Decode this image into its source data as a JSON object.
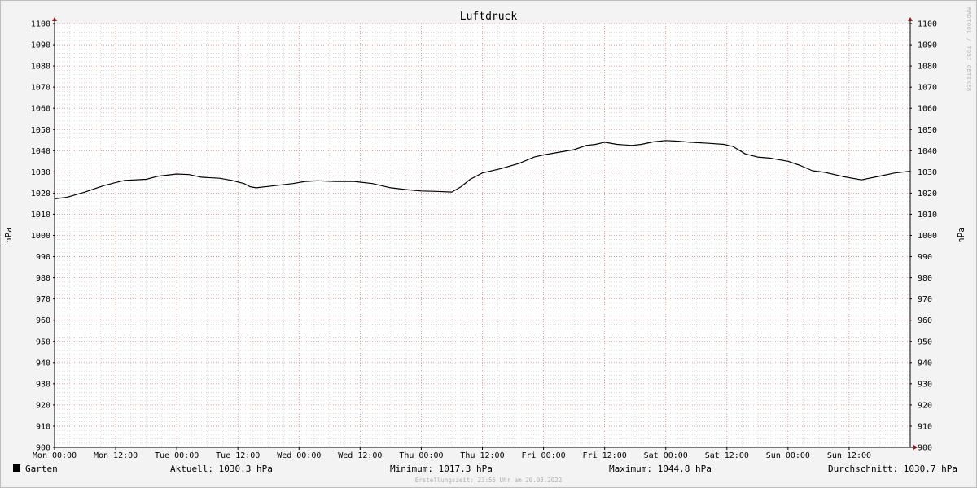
{
  "chart_data": {
    "type": "line",
    "title": "Luftdruck",
    "ylabel": "hPa",
    "ylim": [
      900,
      1100
    ],
    "yticks": [
      900,
      910,
      920,
      930,
      940,
      950,
      960,
      970,
      980,
      990,
      1000,
      1010,
      1020,
      1030,
      1040,
      1050,
      1060,
      1070,
      1080,
      1090,
      1100
    ],
    "x_range": [
      0,
      14
    ],
    "xticks": [
      {
        "x": 0,
        "label": "Mon 00:00"
      },
      {
        "x": 1,
        "label": "Mon 12:00"
      },
      {
        "x": 2,
        "label": "Tue 00:00"
      },
      {
        "x": 3,
        "label": "Tue 12:00"
      },
      {
        "x": 4,
        "label": "Wed 00:00"
      },
      {
        "x": 5,
        "label": "Wed 12:00"
      },
      {
        "x": 6,
        "label": "Thu 00:00"
      },
      {
        "x": 7,
        "label": "Thu 12:00"
      },
      {
        "x": 8,
        "label": "Fri 00:00"
      },
      {
        "x": 9,
        "label": "Fri 12:00"
      },
      {
        "x": 10,
        "label": "Sat 00:00"
      },
      {
        "x": 11,
        "label": "Sat 12:00"
      },
      {
        "x": 12,
        "label": "Sun 00:00"
      },
      {
        "x": 13,
        "label": "Sun 12:00"
      }
    ],
    "grid": true,
    "series": [
      {
        "name": "Garten",
        "color": "#000000",
        "x": [
          0,
          0.2,
          0.5,
          0.8,
          1.0,
          1.15,
          1.5,
          1.7,
          2.0,
          2.2,
          2.4,
          2.7,
          2.9,
          3.1,
          3.2,
          3.3,
          3.6,
          3.9,
          4.1,
          4.3,
          4.6,
          4.9,
          5.2,
          5.5,
          5.8,
          6.0,
          6.25,
          6.5,
          6.65,
          6.8,
          7.0,
          7.3,
          7.6,
          7.85,
          8.0,
          8.2,
          8.5,
          8.7,
          8.85,
          9.0,
          9.2,
          9.45,
          9.6,
          9.8,
          10.0,
          10.2,
          10.4,
          10.7,
          10.95,
          11.1,
          11.3,
          11.5,
          11.7,
          12.0,
          12.2,
          12.4,
          12.6,
          12.9,
          13.2,
          13.5,
          13.75,
          14.0
        ],
        "y": [
          1017.3,
          1018.0,
          1020.5,
          1023.5,
          1025.0,
          1026.0,
          1026.5,
          1028.0,
          1029.0,
          1028.7,
          1027.5,
          1027.0,
          1026.0,
          1024.5,
          1023.0,
          1022.5,
          1023.5,
          1024.5,
          1025.5,
          1025.8,
          1025.5,
          1025.5,
          1024.5,
          1022.5,
          1021.5,
          1021.0,
          1020.8,
          1020.5,
          1023.0,
          1026.5,
          1029.5,
          1031.5,
          1034.0,
          1037.0,
          1038.0,
          1039.0,
          1040.5,
          1042.5,
          1043.0,
          1044.0,
          1043.0,
          1042.5,
          1043.0,
          1044.2,
          1044.8,
          1044.5,
          1044.0,
          1043.5,
          1043.0,
          1042.0,
          1038.5,
          1037.0,
          1036.5,
          1035.0,
          1033.0,
          1030.5,
          1029.8,
          1027.8,
          1026.2,
          1028.0,
          1029.5,
          1030.3
        ]
      }
    ]
  },
  "watermark": "RRDTOOL / TOBI OETIKER",
  "legend": {
    "series_label": "Garten",
    "swatch_color": "#000000"
  },
  "stats": {
    "current": "Aktuell: 1030.3 hPa",
    "minimum": "Minimum: 1017.3 hPa",
    "maximum": "Maximum: 1044.8 hPa",
    "average": "Durchschnitt: 1030.7 hPa"
  },
  "footer": {
    "created": "Erstellungszeit: 23:55 Uhr am 20.03.2022"
  },
  "colors": {
    "background": "#f3f3f3",
    "plot_background": "#ffffff",
    "major_grid": "#e08a8a",
    "minor_grid": "#c8c8c8",
    "axis_arrow": "#8b1a1a"
  }
}
